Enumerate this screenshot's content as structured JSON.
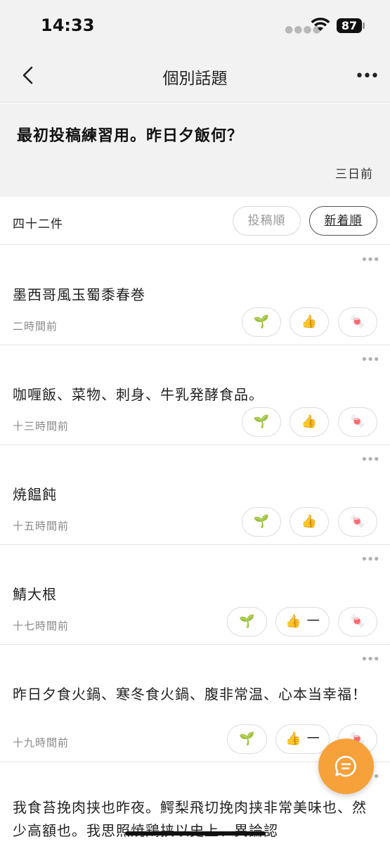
{
  "status": {
    "time": "14:33",
    "battery": "87"
  },
  "nav": {
    "title": "個別話題"
  },
  "topic": {
    "title": "最初投稿練習用。昨日夕飯何？",
    "age": "三日前"
  },
  "sort": {
    "count": "四十二件",
    "post_order": "投稿順",
    "newest": "新着順"
  },
  "replies": [
    {
      "text": "墨西哥風玉蜀黍春巻",
      "time": "二時間前",
      "thumb_count": ""
    },
    {
      "text": "咖喱飯、菜物、刺身、牛乳発酵食品。",
      "time": "十三時間前",
      "thumb_count": ""
    },
    {
      "text": "焼饂飩",
      "time": "十五時間前",
      "thumb_count": ""
    },
    {
      "text": "鯖大根",
      "time": "十七時間前",
      "thumb_count": "一"
    },
    {
      "text": "昨日夕食火鍋、寒冬食火鍋、腹非常温、心本当幸福！",
      "time": "十九時間前",
      "thumb_count": "一"
    },
    {
      "text": "我食苔挽肉挟也昨夜。鰐梨飛切挽肉挟非常美味也、然少高額也。我思照焼鶏挟以史上、異論認",
      "time": "",
      "thumb_count": ""
    }
  ],
  "icons": {
    "sprout": "sprout-icon",
    "thumb": "thumbs-up-icon",
    "candy": "candy-icon",
    "fab": "chat-bubble-icon"
  },
  "colors": {
    "fab": "#f7a13a",
    "header_bg": "#f2f2f2"
  }
}
